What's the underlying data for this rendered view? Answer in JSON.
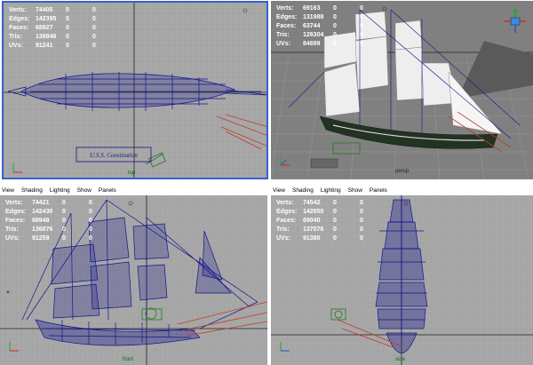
{
  "menus": {
    "left": [
      "View",
      "Shading",
      "Lighting",
      "Show",
      "Panels"
    ],
    "right": [
      "View",
      "Shading",
      "Lighting",
      "Show",
      "Panels"
    ]
  },
  "labels": {
    "verts": "Verts:",
    "edges": "Edges:",
    "faces": "Faces:",
    "tris": "Tris:",
    "uvs": "UVs:"
  },
  "viewports": {
    "top": {
      "camera": "top",
      "plaque": "U.S.S. Constitution",
      "stats": {
        "verts": "74405",
        "edges": "142395",
        "faces": "68927",
        "tris": "136846",
        "uvs": "91241"
      },
      "z1": "0",
      "z2": "0"
    },
    "persp": {
      "camera": "persp",
      "stats": {
        "verts": "69163",
        "edges": "131988",
        "faces": "63744",
        "tris": "126304",
        "uvs": "84699"
      },
      "z1": "0",
      "z2": "0"
    },
    "front": {
      "camera": "front",
      "stats": {
        "verts": "74421",
        "edges": "142430",
        "faces": "68948",
        "tris": "136876",
        "uvs": "91259"
      },
      "z1": "0",
      "z2": "0"
    },
    "side": {
      "camera": "side",
      "stats": {
        "verts": "74542",
        "edges": "142650",
        "faces": "69040",
        "tris": "137076",
        "uvs": "91380"
      },
      "z1": "0",
      "z2": "0"
    }
  },
  "colors": {
    "grid_bg": "#a8a8a8",
    "wire": "#14148c",
    "selection_border": "#3a5fcd",
    "persp_bg": "#7e7e7e"
  }
}
